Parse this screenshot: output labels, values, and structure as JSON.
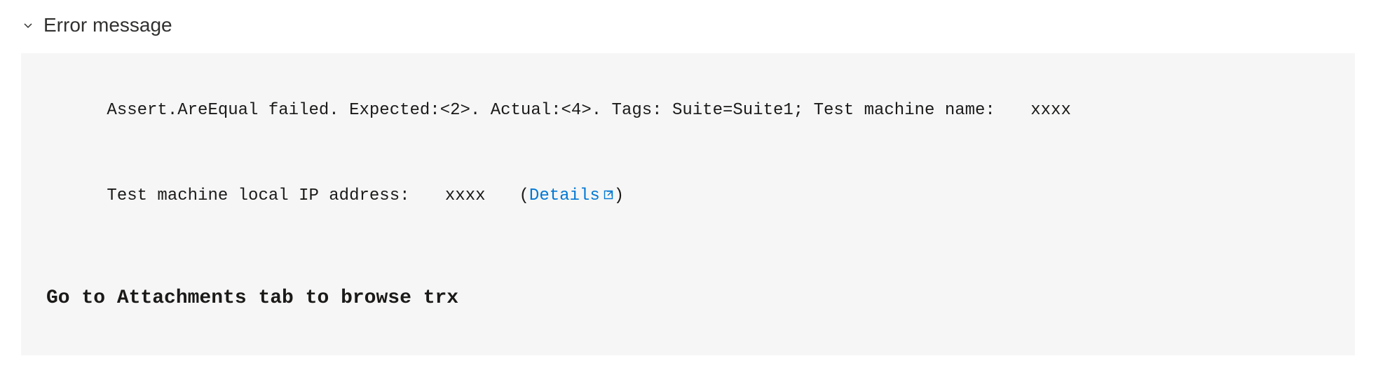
{
  "section": {
    "title": "Error message"
  },
  "error": {
    "line1_prefix": "Assert.AreEqual failed. Expected:<2>. Actual:<4>. Tags: Suite=Suite1; Test machine name: ",
    "line1_masked": "xxxx",
    "line2_prefix": "Test machine local IP address: ",
    "line2_masked": "xxxx",
    "details_label": "Details",
    "bold_line": "Go to Attachments tab to browse trx"
  }
}
